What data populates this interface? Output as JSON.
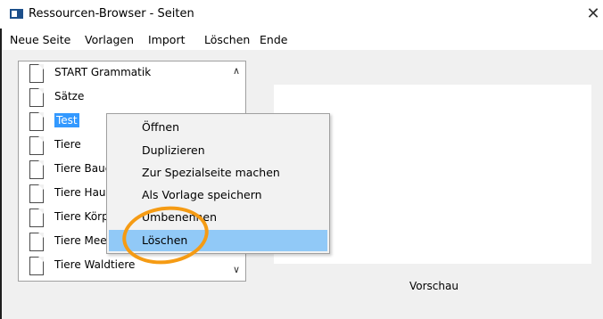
{
  "window": {
    "title": "Ressourcen-Browser - Seiten",
    "close": "✕"
  },
  "menu": [
    "Neue Seite",
    "Vorlagen",
    "Import",
    "Löschen",
    "Ende"
  ],
  "pages": [
    "START Grammatik",
    "Sätze",
    "Test",
    "Tiere",
    "Tiere Baue",
    "Tiere Haus",
    "Tiere Körp",
    "Tiere Meer",
    "Tiere Waldtiere"
  ],
  "selected_page": "Test",
  "context_menu": [
    "Öffnen",
    "Duplizieren",
    "Zur Spezialseite machen",
    "Als Vorlage speichern",
    "Umbenennen",
    "Löschen"
  ],
  "context_menu_highlighted": "Löschen",
  "preview_label": "Vorschau",
  "colors": {
    "selection": "#3399ff",
    "menu_highlight": "#91c9f7",
    "annotation": "#f59b14"
  }
}
